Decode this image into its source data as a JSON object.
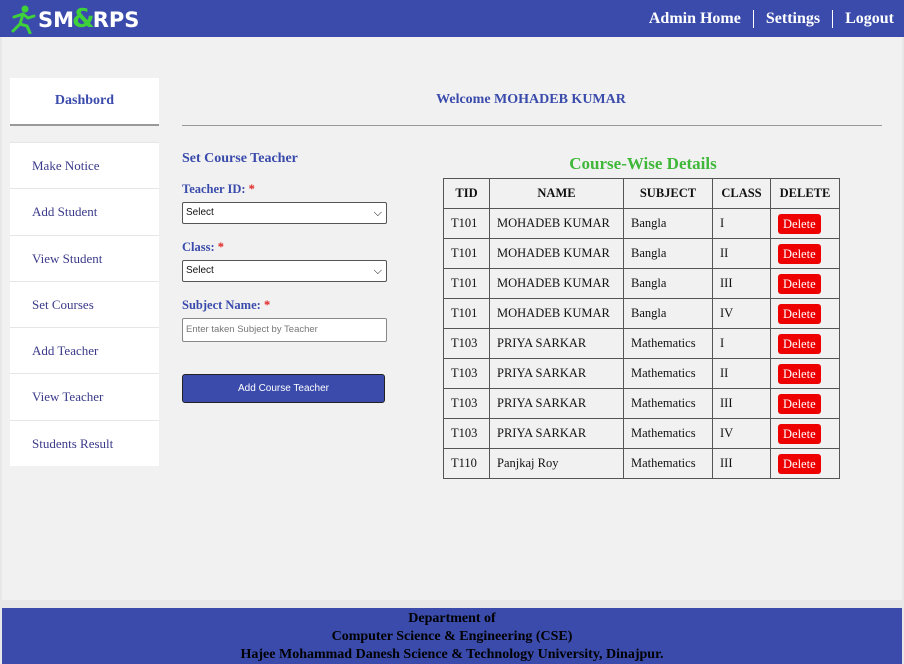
{
  "brand": {
    "logo_text_1": "SM",
    "logo_amp": "&",
    "logo_text_2": "RPS"
  },
  "nav": {
    "items": [
      "Admin Home",
      "Settings",
      "Logout"
    ]
  },
  "sidebar": {
    "header": "Dashbord",
    "items": [
      "Make Notice",
      "Add Student",
      "View Student",
      "Set Courses",
      "Add Teacher",
      "View Teacher",
      "Students Result"
    ]
  },
  "welcome": "Welcome MOHADEB KUMAR",
  "form": {
    "title": "Set Course Teacher",
    "teacher_label": "Teacher ID:",
    "teacher_value": "Select",
    "class_label": "Class:",
    "class_value": "Select",
    "subject_label": "Subject Name:",
    "subject_placeholder": "Enter taken Subject by Teacher",
    "required_mark": "*",
    "submit_label": "Add Course Teacher"
  },
  "table": {
    "title": "Course-Wise Details",
    "headers": [
      "TID",
      "NAME",
      "SUBJECT",
      "CLASS",
      "DELETE"
    ],
    "delete_label": "Delete",
    "rows": [
      [
        "T101",
        "MOHADEB KUMAR",
        "Bangla",
        "I"
      ],
      [
        "T101",
        "MOHADEB KUMAR",
        "Bangla",
        "II"
      ],
      [
        "T101",
        "MOHADEB KUMAR",
        "Bangla",
        "III"
      ],
      [
        "T101",
        "MOHADEB KUMAR",
        "Bangla",
        "IV"
      ],
      [
        "T103",
        "PRIYA SARKAR",
        "Mathematics",
        "I"
      ],
      [
        "T103",
        "PRIYA SARKAR",
        "Mathematics",
        "II"
      ],
      [
        "T103",
        "PRIYA SARKAR",
        "Mathematics",
        "III"
      ],
      [
        "T103",
        "PRIYA SARKAR",
        "Mathematics",
        "IV"
      ],
      [
        "T110",
        "Panjkaj Roy",
        "Mathematics",
        "III"
      ]
    ]
  },
  "footer": {
    "line1": "Department of",
    "line2": "Computer Science & Engineering (CSE)",
    "line3": "Hajee Mohammad Danesh Science & Technology University, Dinajpur."
  },
  "colors": {
    "primary": "#3a4bab",
    "accent": "#3fb83a",
    "danger": "#ee0000"
  }
}
